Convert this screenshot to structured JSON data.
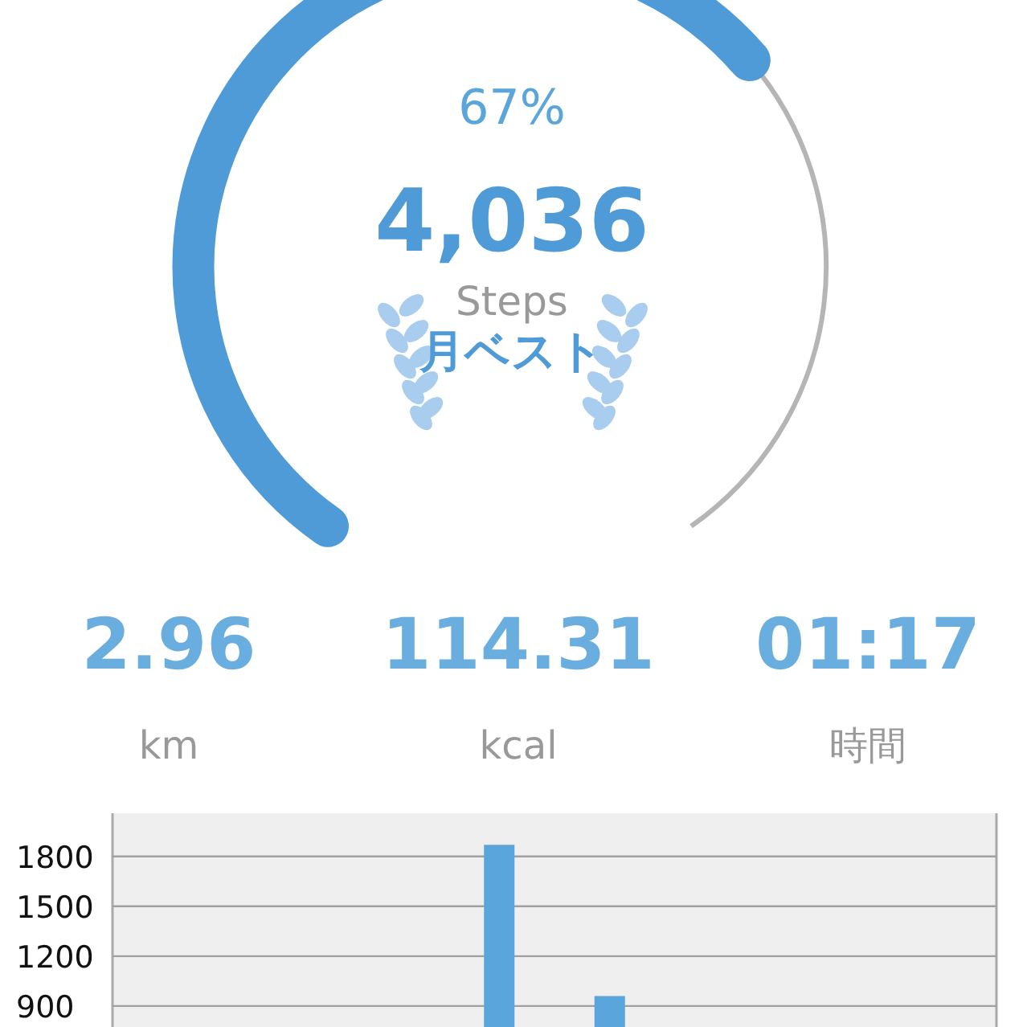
{
  "goal": {
    "percent": "67%",
    "steps": "4,036",
    "unit": "Steps",
    "badge": "月ベスト"
  },
  "stats": [
    {
      "value": "2.96",
      "label": "km"
    },
    {
      "value": "114.31",
      "label": "kcal"
    },
    {
      "value": "01:17",
      "label": "時間"
    }
  ],
  "chart": {
    "chart_data": {
      "type": "bar",
      "grid": true,
      "series": [
        {
          "color": "#5aa5dc",
          "values": [
            0,
            0,
            0,
            0,
            0,
            0,
            0,
            0,
            0,
            0,
            1870,
            0,
            0,
            960,
            0,
            0,
            0,
            0,
            0,
            0,
            0,
            0,
            0,
            0
          ]
        }
      ],
      "ylim": [
        0,
        2060
      ],
      "yticks": [
        900,
        1200,
        1500,
        1800
      ]
    }
  }
}
